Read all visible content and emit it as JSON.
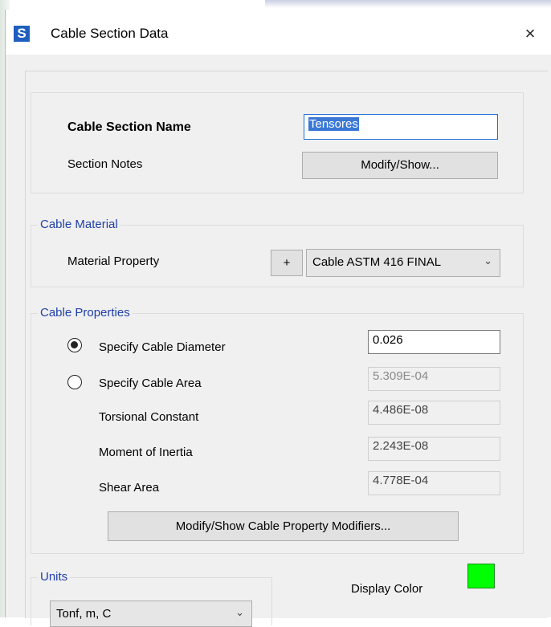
{
  "dialog": {
    "title": "Cable Section Data",
    "app_icon": "S",
    "close_glyph": "×"
  },
  "section": {
    "name_label": "Cable Section Name",
    "name_value": "Tensores",
    "notes_label": "Section Notes",
    "notes_button": "Modify/Show..."
  },
  "material": {
    "group_label": "Cable Material",
    "property_label": "Material Property",
    "add_button": "+",
    "selected": "Cable ASTM 416 FINAL"
  },
  "properties": {
    "group_label": "Cable Properties",
    "diameter_label": "Specify Cable Diameter",
    "diameter_value": "0.026",
    "diameter_selected": true,
    "area_label": "Specify Cable Area",
    "area_value": "5.309E-04",
    "torsional_label": "Torsional Constant",
    "torsional_value": "4.486E-08",
    "inertia_label": "Moment of Inertia",
    "inertia_value": "2.243E-08",
    "shear_label": "Shear Area",
    "shear_value": "4.778E-04",
    "modifiers_button": "Modify/Show Cable Property Modifiers..."
  },
  "units": {
    "group_label": "Units",
    "selected": "Tonf, m, C"
  },
  "display_color": {
    "label": "Display Color",
    "color": "#00ff00"
  },
  "colors": {
    "group_title": "#1f3fa8",
    "dialog_bg": "#f0f0f0",
    "focus_border": "#1e6fd9"
  }
}
